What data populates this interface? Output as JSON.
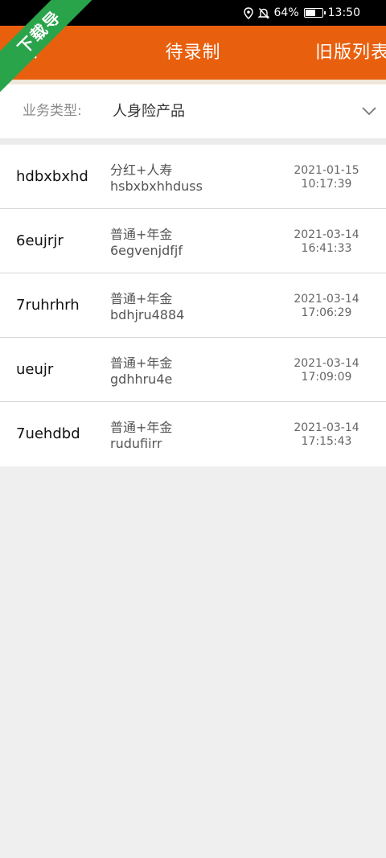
{
  "status_bar": {
    "battery": "64%",
    "time": "13:50",
    "battery_level": 0.64
  },
  "watermark": {
    "text": "下载导"
  },
  "header": {
    "title": "待录制",
    "right_link": "旧版列表"
  },
  "filter": {
    "label": "业务类型:",
    "value": "人身险产品"
  },
  "records": [
    {
      "name": "hdbxbxhd",
      "type": "分红+人寿",
      "code": "hsbxbxhhduss",
      "date": "2021-01-15",
      "time": "10:17:39"
    },
    {
      "name": "6eujrjr",
      "type": "普通+年金",
      "code": "6egvenjdfjf",
      "date": "2021-03-14",
      "time": "16:41:33"
    },
    {
      "name": "7ruhrhrh",
      "type": "普通+年金",
      "code": "bdhjru4884",
      "date": "2021-03-14",
      "time": "17:06:29"
    },
    {
      "name": "ueujr",
      "type": "普通+年金",
      "code": "gdhhru4e",
      "date": "2021-03-14",
      "time": "17:09:09"
    },
    {
      "name": "7uehdbd",
      "type": "普通+年金",
      "code": "rudufiirr",
      "date": "2021-03-14",
      "time": "17:15:43"
    }
  ],
  "colors": {
    "header": "#e8600e",
    "ribbon": "#2aa44b"
  }
}
